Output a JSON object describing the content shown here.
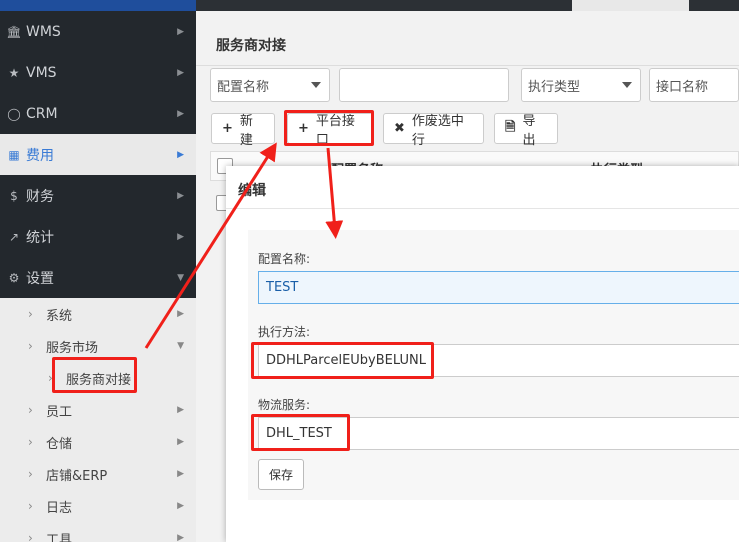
{
  "sidebar": {
    "menu": [
      {
        "label": "WMS",
        "icon": "bank-icon"
      },
      {
        "label": "VMS",
        "icon": "star-icon"
      },
      {
        "label": "CRM",
        "icon": "user-icon"
      },
      {
        "label": "费用",
        "icon": "table-icon"
      },
      {
        "label": "财务",
        "icon": "dollar-icon"
      },
      {
        "label": "统计",
        "icon": "chart-line-icon"
      },
      {
        "label": "设置",
        "icon": "gear-icon"
      }
    ],
    "submenu": [
      {
        "label": "系统"
      },
      {
        "label": "服务市场"
      },
      {
        "label": "服务商对接"
      },
      {
        "label": "员工"
      },
      {
        "label": "仓储"
      },
      {
        "label": "店铺&ERP"
      },
      {
        "label": "日志"
      },
      {
        "label": "工具"
      }
    ]
  },
  "main": {
    "title": "服务商对接",
    "filters": {
      "config_name": "配置名称",
      "exec_type": "执行类型",
      "api_name": "接口名称"
    },
    "toolbar": {
      "new": "新建",
      "platform_api": "平台接口",
      "void_selected": "作废选中行",
      "export": "导出"
    },
    "table": {
      "col_config_name": "配置名称",
      "col_exec_type": "执行类型"
    }
  },
  "modal": {
    "title": "编辑",
    "config_name_label": "配置名称:",
    "config_name_value": "TEST",
    "exec_method_label": "执行方法:",
    "exec_method_value": "DDHLParcelEUbyBELUNL",
    "logistics_label": "物流服务:",
    "logistics_value": "DHL_TEST",
    "save": "保存"
  },
  "colors": {
    "highlight": "#f0201a",
    "sidebar_bg": "#23282d",
    "accent": "#3a7bd5"
  }
}
